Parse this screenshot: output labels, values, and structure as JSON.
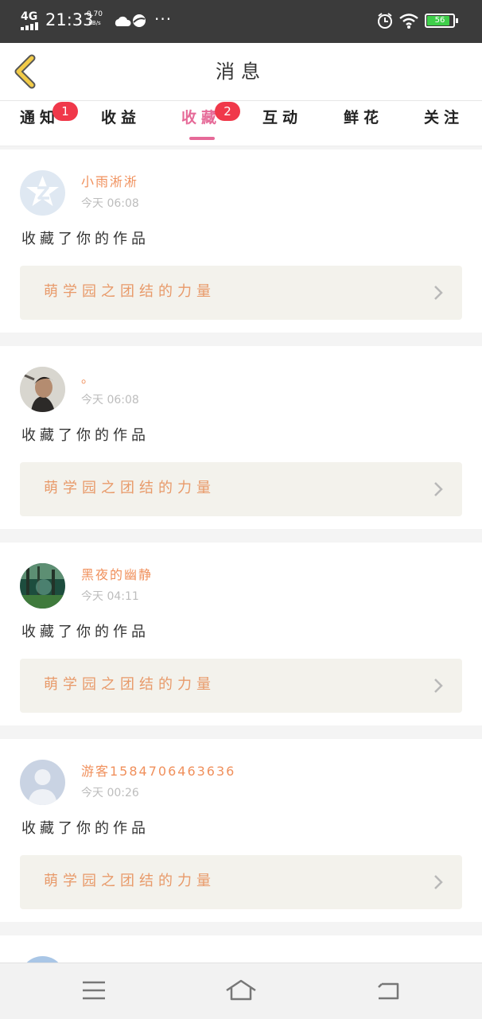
{
  "status_bar": {
    "network": "4G",
    "time": "21:33",
    "speed_value": "0.70",
    "speed_unit": "KB/s",
    "more": "···",
    "battery_level": "56",
    "icons": [
      "signal-icon",
      "cloud-icon",
      "browser-icon",
      "alarm-icon",
      "wifi-icon",
      "battery-icon"
    ]
  },
  "header": {
    "title": "消息"
  },
  "tabs": [
    {
      "label": "通知",
      "badge": "1"
    },
    {
      "label": "收益"
    },
    {
      "label": "收藏",
      "badge": "2",
      "active": true
    },
    {
      "label": "互动"
    },
    {
      "label": "鲜花"
    },
    {
      "label": "关注"
    }
  ],
  "messages": [
    {
      "user": "小雨淅淅",
      "time": "今天 06:08",
      "action": "收藏了你的作品",
      "work_title": "萌学园之团结的力量",
      "avatar": "qzone-default-avatar"
    },
    {
      "user": "。",
      "time": "今天 06:08",
      "action": "收藏了你的作品",
      "work_title": "萌学园之团结的力量",
      "avatar": "photo-avatar"
    },
    {
      "user": "黑夜的幽静",
      "time": "今天 04:11",
      "action": "收藏了你的作品",
      "work_title": "萌学园之团结的力量",
      "avatar": "forest-avatar"
    },
    {
      "user": "游客1584706463636",
      "time": "今天 00:26",
      "action": "收藏了你的作品",
      "work_title": "萌学园之团结的力量",
      "avatar": "default-user-avatar"
    }
  ],
  "nav_bar": {
    "icons": [
      "menu-icon",
      "home-icon",
      "back-icon"
    ]
  },
  "colors": {
    "accent": "#e66a98",
    "username": "#f0905c",
    "work_title": "#e89a6a",
    "badge": "#f0384a"
  }
}
